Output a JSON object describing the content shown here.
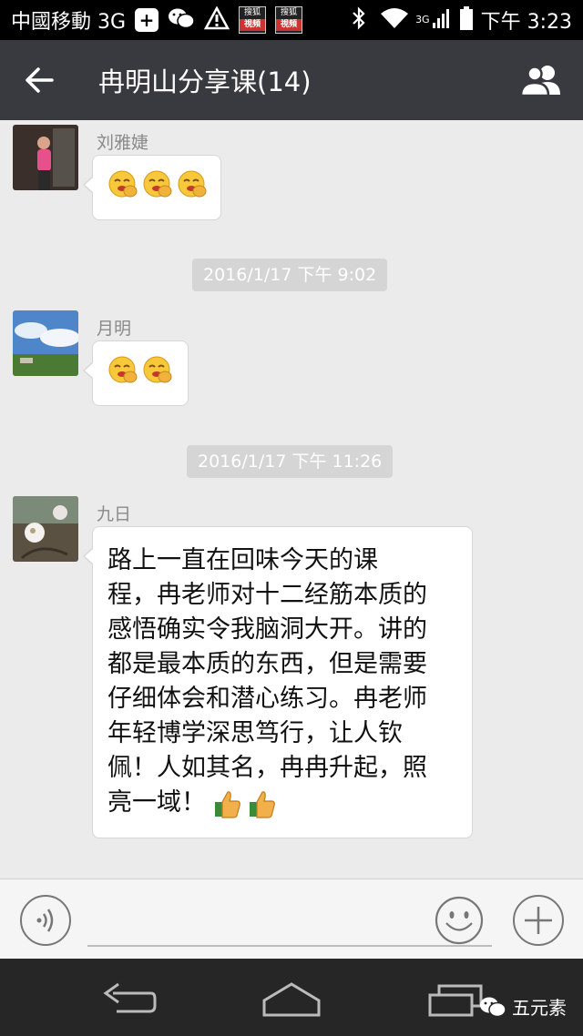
{
  "status_bar": {
    "carrier": "中國移動 3G",
    "tag1": [
      "搜狐",
      "視頻"
    ],
    "tag2": [
      "搜狐",
      "視頻"
    ],
    "network": "3G",
    "time": "下午 3:23"
  },
  "header": {
    "title": "冉明山分享课(14)"
  },
  "messages": [
    {
      "sender": "刘雅婕",
      "type": "emoji",
      "emoji_count": 3,
      "emoji": "grin-hand-emoji"
    },
    {
      "type": "timestamp",
      "text": "2016/1/17 下午 9:02"
    },
    {
      "sender": "月明",
      "type": "emoji",
      "emoji_count": 2,
      "emoji": "grin-hand-emoji"
    },
    {
      "type": "timestamp",
      "text": "2016/1/17 下午 11:26"
    },
    {
      "sender": "九日",
      "type": "text",
      "lines": [
        "路上一直在回味今天的课",
        "程，冉老师对十二经筋本质的",
        "感悟确实令我脑洞大开。讲的",
        "都是最本质的东西，但是需要",
        "仔细体会和潜心练习。冉老师",
        "年轻博学深思笃行，让人钦",
        "佩！人如其名，冉冉升起，照",
        "亮一域！"
      ],
      "trailing_emoji": "thumbs-up-emoji",
      "trailing_emoji_count": 2
    }
  ],
  "watermark": "五元素",
  "colors": {
    "title_bar": "#393a3f",
    "chat_bg": "#ebebeb",
    "timestamp_bg": "#d5d5d5"
  }
}
